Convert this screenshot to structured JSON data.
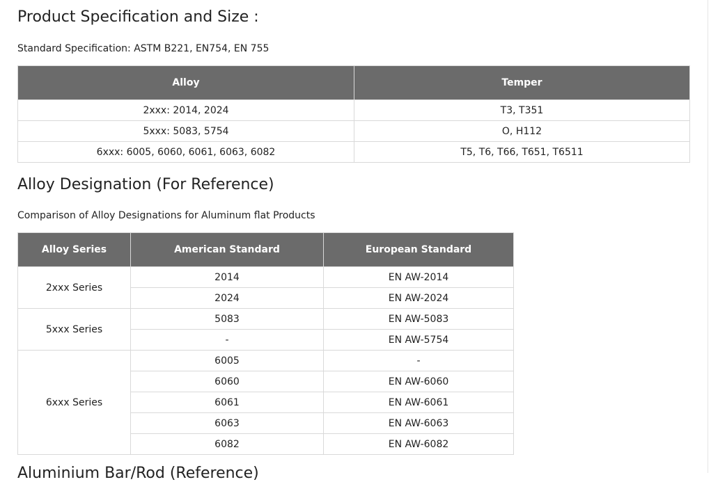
{
  "section1": {
    "title": "Product Specification and Size :",
    "note": "Standard Specification: ASTM B221, EN754, EN 755",
    "headers": [
      "Alloy",
      "Temper"
    ],
    "rows": [
      [
        "2xxx: 2014, 2024",
        "T3, T351"
      ],
      [
        "5xxx: 5083, 5754",
        "O, H112"
      ],
      [
        "6xxx: 6005, 6060, 6061, 6063, 6082",
        "T5, T6, T66, T651, T6511"
      ]
    ]
  },
  "section2": {
    "title": "Alloy Designation (For Reference)",
    "note": "Comparison of Alloy Designations for Aluminum flat Products",
    "headers": [
      "Alloy Series",
      "American Standard",
      "European Standard"
    ],
    "groups": [
      {
        "series": "2xxx Series",
        "rows": [
          [
            "2014",
            "EN AW-2014"
          ],
          [
            "2024",
            "EN AW-2024"
          ]
        ]
      },
      {
        "series": "5xxx Series",
        "rows": [
          [
            "5083",
            "EN AW-5083"
          ],
          [
            "-",
            "EN AW-5754"
          ]
        ]
      },
      {
        "series": "6xxx Series",
        "rows": [
          [
            "6005",
            "-"
          ],
          [
            "6060",
            "EN AW-6060"
          ],
          [
            "6061",
            "EN AW-6061"
          ],
          [
            "6063",
            "EN AW-6063"
          ],
          [
            "6082",
            "EN AW-6082"
          ]
        ]
      }
    ]
  },
  "section3": {
    "title_partial": "Aluminium Bar/Rod (Reference)"
  }
}
